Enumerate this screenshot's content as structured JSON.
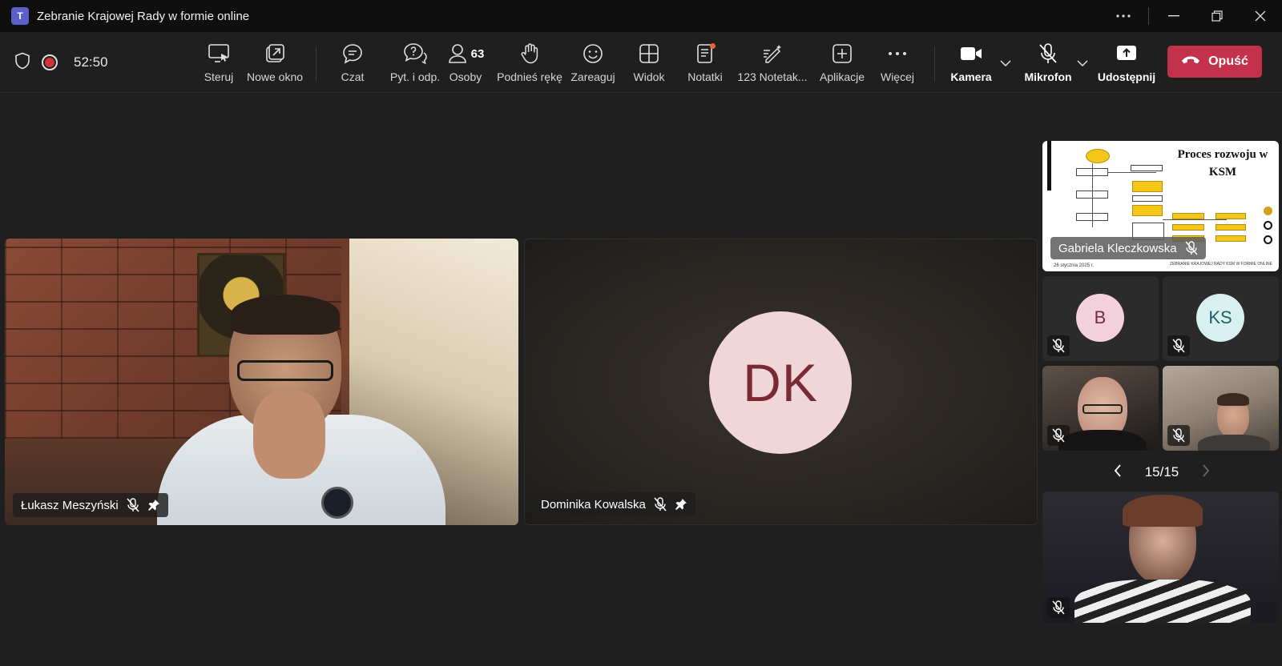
{
  "window": {
    "title": "Zebranie Krajowej Rady w formie online",
    "app_logo": "T"
  },
  "meeting": {
    "timer": "52:50"
  },
  "toolbar": {
    "items": [
      {
        "label": "Steruj",
        "icon": "control-screen-icon"
      },
      {
        "label": "Nowe okno",
        "icon": "pop-out-icon"
      },
      {
        "label": "Czat",
        "icon": "chat-icon"
      },
      {
        "label": "Pyt. i odp.",
        "icon": "qa-icon"
      },
      {
        "label": "Osoby",
        "icon": "people-icon",
        "count": "63"
      },
      {
        "label": "Podnieś rękę",
        "icon": "raise-hand-icon"
      },
      {
        "label": "Zareaguj",
        "icon": "react-icon"
      },
      {
        "label": "Widok",
        "icon": "view-icon"
      },
      {
        "label": "Notatki",
        "icon": "notes-icon"
      },
      {
        "label": "123 Notetak...",
        "icon": "notetaker-icon"
      },
      {
        "label": "Aplikacje",
        "icon": "apps-icon"
      },
      {
        "label": "Więcej",
        "icon": "more-icon"
      }
    ],
    "camera": "Kamera",
    "microphone": "Mikrofon",
    "share": "Udostępnij",
    "leave": "Opuść"
  },
  "participants": {
    "main": [
      {
        "name": "Łukasz Meszyński",
        "muted": true,
        "pinned": true
      },
      {
        "name": "Dominika Kowalska",
        "initials": "DK",
        "muted": true,
        "pinned": true
      }
    ],
    "shared_tile": {
      "name": "Gabriela Kleczkowska",
      "slide_title": "Proces rozwoju w KSM",
      "slide_date": "26 stycznia 2025 r.",
      "slide_footer": "ZEBRANIE KRAJOWEJ RADY KSM W FORMIE ONLINE"
    },
    "small": [
      {
        "initials": "B",
        "bg": "#f3d1dc",
        "fg": "#7a2a40"
      },
      {
        "initials": "KS",
        "bg": "#d9f0f0",
        "fg": "#1f5f63"
      }
    ]
  },
  "pager": {
    "text": "15/15"
  },
  "colors": {
    "leave": "#c4314b",
    "background": "#1f1f1f",
    "record": "#d13438"
  }
}
